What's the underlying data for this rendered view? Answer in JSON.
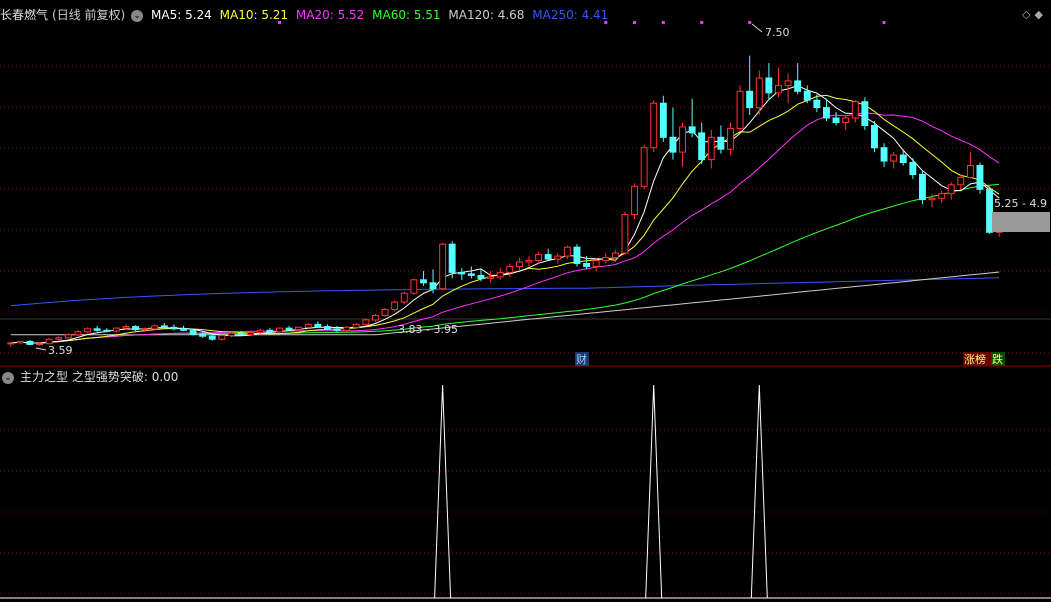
{
  "header": {
    "stock_name": "长春燃气",
    "period_label": "(日线 前复权)",
    "ma": [
      {
        "label": "MA5: 5.24",
        "color": "#ffffff"
      },
      {
        "label": "MA10: 5.21",
        "color": "#ffff33"
      },
      {
        "label": "MA20: 5.52",
        "color": "#ff33ff"
      },
      {
        "label": "MA60: 5.51",
        "color": "#33ff33"
      },
      {
        "label": "MA120: 4.68",
        "color": "#cccccc"
      },
      {
        "label": "MA250: 4.41",
        "color": "#3355ff"
      }
    ]
  },
  "annotations": {
    "high": "7.50",
    "low": "3.59",
    "mid_range": "3.83 - 3.95",
    "last_range": "5.25 - 4.9",
    "badge_cai": "财",
    "badge_zhangbang": "涨榜",
    "badge_die": "跌"
  },
  "indicator": {
    "title": "主力之型",
    "value_label": "之型强势突破: 0.00"
  },
  "colors": {
    "up": "#ff3232",
    "down": "#54ffff",
    "grid": "#8b0000",
    "ma5": "#ffffff",
    "ma10": "#ffff33",
    "ma20": "#ff33ff",
    "ma60": "#33ff33",
    "ma120": "#cccccc",
    "ma250": "#3355ff"
  },
  "chart_data": {
    "type": "candlestick",
    "ylim": [
      3.4,
      7.9
    ],
    "candles": [
      [
        3.62,
        3.64,
        3.58,
        3.63
      ],
      [
        3.63,
        3.66,
        3.61,
        3.65
      ],
      [
        3.65,
        3.67,
        3.6,
        3.61
      ],
      [
        3.61,
        3.63,
        3.59,
        3.62
      ],
      [
        3.62,
        3.7,
        3.61,
        3.68
      ],
      [
        3.68,
        3.72,
        3.66,
        3.7
      ],
      [
        3.7,
        3.76,
        3.69,
        3.74
      ],
      [
        3.74,
        3.8,
        3.72,
        3.78
      ],
      [
        3.78,
        3.84,
        3.76,
        3.82
      ],
      [
        3.82,
        3.86,
        3.78,
        3.8
      ],
      [
        3.8,
        3.83,
        3.77,
        3.79
      ],
      [
        3.79,
        3.84,
        3.77,
        3.83
      ],
      [
        3.83,
        3.88,
        3.81,
        3.85
      ],
      [
        3.85,
        3.87,
        3.79,
        3.81
      ],
      [
        3.81,
        3.84,
        3.78,
        3.82
      ],
      [
        3.82,
        3.88,
        3.8,
        3.86
      ],
      [
        3.86,
        3.9,
        3.83,
        3.84
      ],
      [
        3.84,
        3.88,
        3.8,
        3.82
      ],
      [
        3.82,
        3.86,
        3.79,
        3.8
      ],
      [
        3.8,
        3.82,
        3.73,
        3.75
      ],
      [
        3.75,
        3.78,
        3.7,
        3.72
      ],
      [
        3.72,
        3.76,
        3.66,
        3.68
      ],
      [
        3.68,
        3.74,
        3.66,
        3.73
      ],
      [
        3.73,
        3.78,
        3.71,
        3.76
      ],
      [
        3.76,
        3.79,
        3.73,
        3.74
      ],
      [
        3.74,
        3.78,
        3.72,
        3.77
      ],
      [
        3.77,
        3.82,
        3.75,
        3.8
      ],
      [
        3.8,
        3.83,
        3.76,
        3.78
      ],
      [
        3.78,
        3.84,
        3.77,
        3.83
      ],
      [
        3.83,
        3.86,
        3.79,
        3.81
      ],
      [
        3.81,
        3.85,
        3.79,
        3.84
      ],
      [
        3.84,
        3.9,
        3.82,
        3.88
      ],
      [
        3.88,
        3.92,
        3.83,
        3.85
      ],
      [
        3.85,
        3.88,
        3.8,
        3.82
      ],
      [
        3.82,
        3.86,
        3.78,
        3.8
      ],
      [
        3.8,
        3.86,
        3.78,
        3.84
      ],
      [
        3.84,
        3.9,
        3.83,
        3.88
      ],
      [
        3.88,
        3.96,
        3.86,
        3.94
      ],
      [
        3.94,
        4.02,
        3.91,
        4.0
      ],
      [
        4.0,
        4.1,
        3.98,
        4.08
      ],
      [
        4.08,
        4.2,
        4.05,
        4.18
      ],
      [
        4.18,
        4.32,
        4.15,
        4.3
      ],
      [
        4.3,
        4.5,
        4.28,
        4.48
      ],
      [
        4.48,
        4.6,
        4.4,
        4.44
      ],
      [
        4.44,
        4.62,
        4.3,
        4.36
      ],
      [
        4.36,
        4.98,
        4.34,
        4.96
      ],
      [
        4.96,
        5.0,
        4.5,
        4.58
      ],
      [
        4.58,
        4.64,
        4.48,
        4.56
      ],
      [
        4.56,
        4.66,
        4.5,
        4.54
      ],
      [
        4.54,
        4.62,
        4.46,
        4.5
      ],
      [
        4.5,
        4.6,
        4.44,
        4.52
      ],
      [
        4.52,
        4.64,
        4.48,
        4.58
      ],
      [
        4.58,
        4.7,
        4.52,
        4.66
      ],
      [
        4.66,
        4.78,
        4.6,
        4.72
      ],
      [
        4.72,
        4.8,
        4.66,
        4.74
      ],
      [
        4.74,
        4.86,
        4.7,
        4.82
      ],
      [
        4.82,
        4.9,
        4.74,
        4.76
      ],
      [
        4.76,
        4.84,
        4.7,
        4.8
      ],
      [
        4.8,
        4.94,
        4.76,
        4.92
      ],
      [
        4.92,
        4.96,
        4.66,
        4.7
      ],
      [
        4.7,
        4.8,
        4.62,
        4.66
      ],
      [
        4.66,
        4.78,
        4.6,
        4.74
      ],
      [
        4.74,
        4.84,
        4.7,
        4.78
      ],
      [
        4.78,
        4.88,
        4.72,
        4.84
      ],
      [
        4.84,
        5.4,
        4.82,
        5.36
      ],
      [
        5.36,
        5.78,
        5.3,
        5.74
      ],
      [
        5.74,
        6.3,
        5.7,
        6.26
      ],
      [
        6.26,
        6.9,
        6.2,
        6.86
      ],
      [
        6.86,
        6.96,
        6.34,
        6.4
      ],
      [
        6.4,
        6.8,
        6.1,
        6.2
      ],
      [
        6.2,
        6.6,
        6.0,
        6.54
      ],
      [
        6.54,
        6.92,
        6.4,
        6.46
      ],
      [
        6.46,
        6.6,
        6.04,
        6.1
      ],
      [
        6.1,
        6.5,
        5.98,
        6.4
      ],
      [
        6.4,
        6.56,
        6.18,
        6.24
      ],
      [
        6.24,
        6.6,
        6.16,
        6.52
      ],
      [
        6.52,
        7.1,
        6.48,
        7.02
      ],
      [
        7.02,
        7.5,
        6.7,
        6.8
      ],
      [
        6.8,
        7.3,
        6.7,
        7.2
      ],
      [
        7.2,
        7.4,
        6.9,
        7.0
      ],
      [
        7.0,
        7.34,
        6.94,
        7.1
      ],
      [
        7.1,
        7.26,
        6.86,
        7.16
      ],
      [
        7.16,
        7.4,
        6.98,
        7.02
      ],
      [
        7.02,
        7.1,
        6.86,
        6.9
      ],
      [
        6.9,
        6.98,
        6.74,
        6.8
      ],
      [
        6.8,
        6.92,
        6.62,
        6.66
      ],
      [
        6.66,
        6.74,
        6.56,
        6.6
      ],
      [
        6.6,
        6.7,
        6.5,
        6.66
      ],
      [
        6.66,
        6.9,
        6.6,
        6.88
      ],
      [
        6.88,
        6.94,
        6.5,
        6.56
      ],
      [
        6.56,
        6.62,
        6.2,
        6.26
      ],
      [
        6.26,
        6.32,
        6.0,
        6.08
      ],
      [
        6.08,
        6.2,
        5.98,
        6.16
      ],
      [
        6.16,
        6.24,
        6.02,
        6.06
      ],
      [
        6.06,
        6.12,
        5.84,
        5.9
      ],
      [
        5.9,
        5.96,
        5.5,
        5.56
      ],
      [
        5.56,
        5.64,
        5.46,
        5.58
      ],
      [
        5.58,
        5.68,
        5.52,
        5.64
      ],
      [
        5.64,
        5.8,
        5.56,
        5.76
      ],
      [
        5.76,
        5.9,
        5.7,
        5.86
      ],
      [
        5.86,
        6.2,
        5.84,
        6.02
      ],
      [
        6.02,
        6.06,
        5.64,
        5.7
      ],
      [
        5.7,
        5.74,
        5.1,
        5.12
      ],
      [
        5.12,
        5.24,
        5.06,
        5.2
      ]
    ],
    "signal_peaks": [
      45,
      67,
      78
    ]
  }
}
